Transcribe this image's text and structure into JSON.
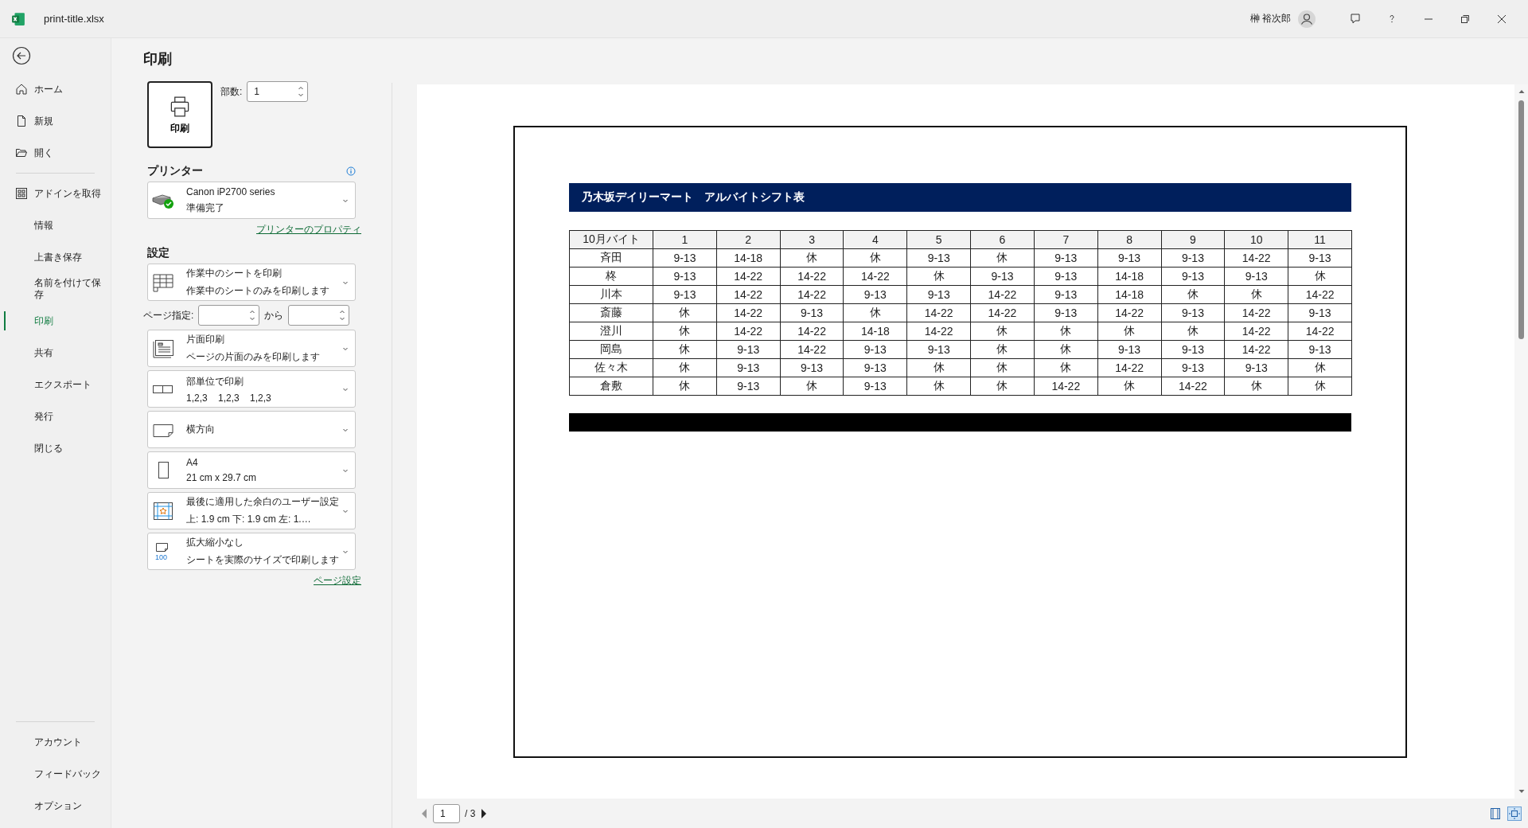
{
  "window": {
    "title": "print-title.xlsx",
    "user": "榊 裕次郎"
  },
  "nav": {
    "top": [
      {
        "label": "ホーム",
        "kind": "home",
        "selected": false
      },
      {
        "label": "新規",
        "kind": "new",
        "selected": false
      },
      {
        "label": "開く",
        "kind": "open",
        "selected": false
      }
    ],
    "main": [
      {
        "label": "アドインを取得",
        "kind": "addins",
        "selected": false
      },
      {
        "label": "情報",
        "kind": "text",
        "selected": false
      },
      {
        "label": "上書き保存",
        "kind": "text",
        "selected": false
      },
      {
        "label": "名前を付けて保存",
        "kind": "text",
        "selected": false
      },
      {
        "label": "印刷",
        "kind": "text",
        "selected": true
      },
      {
        "label": "共有",
        "kind": "text",
        "selected": false
      },
      {
        "label": "エクスポート",
        "kind": "text",
        "selected": false
      },
      {
        "label": "発行",
        "kind": "text",
        "selected": false
      },
      {
        "label": "閉じる",
        "kind": "text",
        "selected": false
      }
    ],
    "bottom": [
      {
        "label": "アカウント",
        "selected": false
      },
      {
        "label": "フィードバック",
        "selected": false
      },
      {
        "label": "オプション",
        "selected": false
      }
    ]
  },
  "print": {
    "heading": "印刷",
    "button": "印刷",
    "copies_label": "部数:",
    "copies": "1"
  },
  "printer": {
    "heading": "プリンター",
    "name": "Canon iP2700 series",
    "status": "準備完了",
    "properties_link": "プリンターのプロパティ"
  },
  "settings": {
    "heading": "設定",
    "items": [
      {
        "kind": "sheets",
        "title": "作業中のシートを印刷",
        "subtitle": "作業中のシートのみを印刷します"
      },
      {
        "kind": "range",
        "label": "ページ指定:",
        "to_label": "から"
      },
      {
        "kind": "sides",
        "title": "片面印刷",
        "subtitle": "ページの片面のみを印刷します"
      },
      {
        "kind": "collate",
        "title": "部単位で印刷",
        "subtitle": "1,2,3    1,2,3    1,2,3"
      },
      {
        "kind": "orientation",
        "title": "横方向"
      },
      {
        "kind": "paper",
        "title": "A4",
        "subtitle": "21 cm x 29.7 cm"
      },
      {
        "kind": "margins",
        "title": "最後に適用した余白のユーザー設定",
        "subtitle": "上: 1.9 cm 下: 1.9 cm 左: 1.…"
      },
      {
        "kind": "scaling",
        "title": "拡大縮小なし",
        "subtitle": "シートを実際のサイズで印刷します",
        "icon_text": "100"
      }
    ],
    "page_setup_link": "ページ設定"
  },
  "preview": {
    "sheet_title": "乃木坂デイリーマート　アルバイトシフト表",
    "columns": [
      "10月バイト",
      "1",
      "2",
      "3",
      "4",
      "5",
      "6",
      "7",
      "8",
      "9",
      "10",
      "11"
    ],
    "rows": [
      {
        "cells": [
          "斉田",
          "9-13",
          "14-18",
          "休",
          "休",
          "9-13",
          "休",
          "9-13",
          "9-13",
          "9-13",
          "14-22",
          "9-13"
        ]
      },
      {
        "cells": [
          "柊",
          "9-13",
          "14-22",
          "14-22",
          "14-22",
          "休",
          "9-13",
          "9-13",
          "14-18",
          "9-13",
          "9-13",
          "休"
        ]
      },
      {
        "cells": [
          "川本",
          "9-13",
          "14-22",
          "14-22",
          "9-13",
          "9-13",
          "14-22",
          "9-13",
          "14-18",
          "休",
          "休",
          "14-22"
        ]
      },
      {
        "cells": [
          "斎藤",
          "休",
          "14-22",
          "9-13",
          "休",
          "14-22",
          "14-22",
          "9-13",
          "14-22",
          "9-13",
          "14-22",
          "9-13"
        ]
      },
      {
        "cells": [
          "澄川",
          "休",
          "14-22",
          "14-22",
          "14-18",
          "14-22",
          "休",
          "休",
          "休",
          "休",
          "14-22",
          "14-22"
        ]
      },
      {
        "cells": [
          "岡島",
          "休",
          "9-13",
          "14-22",
          "9-13",
          "9-13",
          "休",
          "休",
          "9-13",
          "9-13",
          "14-22",
          "9-13"
        ]
      },
      {
        "cells": [
          "佐々木",
          "休",
          "9-13",
          "9-13",
          "9-13",
          "休",
          "休",
          "休",
          "14-22",
          "9-13",
          "9-13",
          "休"
        ]
      },
      {
        "cells": [
          "倉敷",
          "休",
          "9-13",
          "休",
          "9-13",
          "休",
          "休",
          "14-22",
          "休",
          "14-22",
          "休",
          "休"
        ]
      }
    ],
    "page": "1",
    "page_total": "/ 3"
  }
}
